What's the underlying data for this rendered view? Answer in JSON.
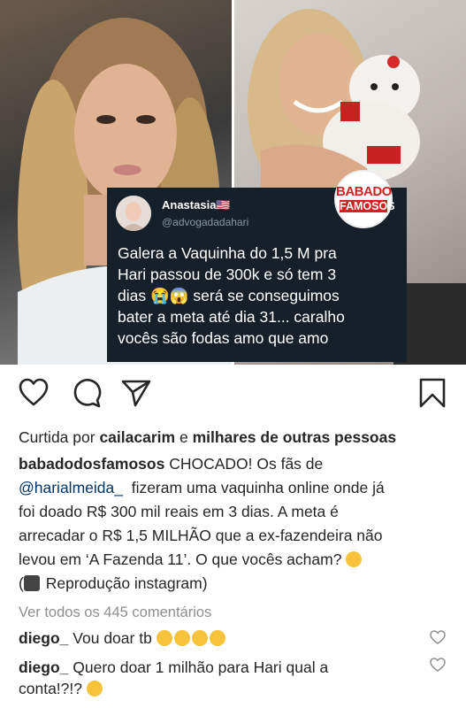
{
  "tweet": {
    "name": "Anastasia🇺🇸",
    "handle": "@advogadadahari",
    "body_lines": [
      "Galera a Vaquinha do 1,5 M pra",
      "Hari passou de 300k e só tem 3",
      "dias 😭😱 será se conseguimos",
      "bater a meta até dia 31... caralho",
      "vocês são fodas amo que amo"
    ]
  },
  "brand": {
    "line1": "BABADO",
    "line2": "FAMOSOS"
  },
  "actions": {
    "like_icon": "heart-icon",
    "comment_icon": "comment-icon",
    "share_icon": "send-icon",
    "save_icon": "bookmark-icon"
  },
  "likes": {
    "prefix": "Curtida por",
    "user": "cailacarim",
    "conj": "e",
    "others": "milhares de outras pessoas"
  },
  "caption": {
    "user": "babadodosfamosos",
    "line1": "CHOCADO! Os fãs de",
    "mention": "@harialmeida_",
    "line2": "fizeram uma vaquinha online onde já",
    "line3": "foi doado R$ 300 mil reais em 3 dias. A meta é",
    "line4": "arrecadar o R$ 1,5 MILHÃO que a ex-fazendeira não",
    "line5": "levou em ‘A Fazenda 11’. O que vocês acham?",
    "line6": "Reprodução instagram)",
    "line6_prefix": "("
  },
  "view_all": "Ver todos os 445 comentários",
  "comments": [
    {
      "user": "diego_",
      "text": "Vou doar tb",
      "emoji_count": 4
    },
    {
      "user": "diego_",
      "text": "Quero doar 1 milhão para Hari qual a",
      "text2": "conta!?!?"
    }
  ],
  "colors": {
    "accent_link": "#003569",
    "muted": "#8e8e8e",
    "tweet_bg": "#15202b",
    "brand_red": "#d42020"
  }
}
